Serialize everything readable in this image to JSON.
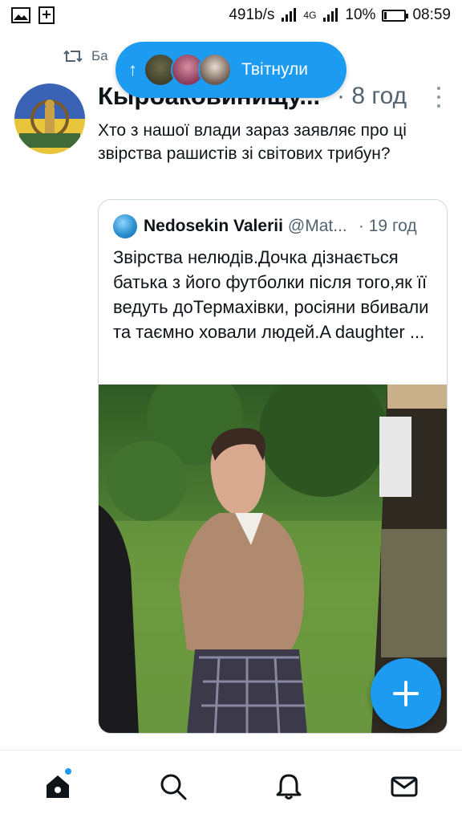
{
  "status_bar": {
    "speed": "491b/s",
    "network": "4G",
    "battery": "10%",
    "battery_level": 0.1,
    "time": "08:59"
  },
  "tweet": {
    "retweet_context": "Ба",
    "author_name": "Кырбаковинищу...",
    "time": "· 8 год",
    "text": "Хто з нашої влади зараз заявляє про ці звірства рашистів зі світових трибун?",
    "quote": {
      "author_name": "Nedosekin Valerii",
      "handle": "@Mat...",
      "time": "· 19 год",
      "text": "Звірства нелюдів.Дочка дізнається батька з його футболки після того,як її ведуть доТермахівки, росіяни вбивали та таємно ховали людей.A daughter ..."
    }
  },
  "retweet_banner": {
    "label": "Твітнули"
  },
  "colors": {
    "accent": "#1d9bf0",
    "text": "#0f1419",
    "muted": "#536471"
  },
  "icons": {
    "fab": "compose-plus-icon",
    "nav": [
      "home-icon",
      "search-icon",
      "bell-icon",
      "mail-icon"
    ]
  }
}
